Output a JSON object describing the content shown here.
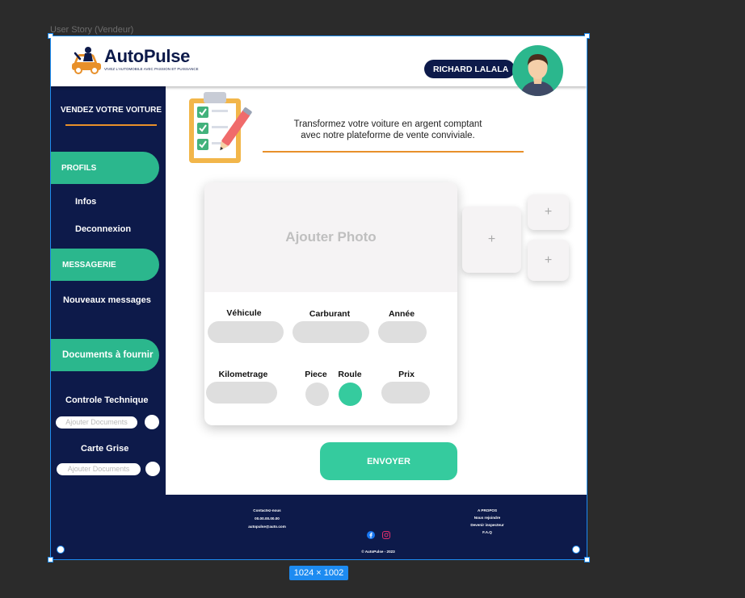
{
  "canvas": {
    "frame_label": "User Story (Vendeur)",
    "size_badge": "1024 × 1002"
  },
  "header": {
    "brand_name": "AutoPulse",
    "brand_tagline": "VIVEZ L'AUTOMOBILE AVEC PASSION ET PUISSANCE",
    "user_name": "RICHARD LALALA"
  },
  "sidebar": {
    "title": "VENDEZ VOTRE VOITURE",
    "profils_label": "PROFILS",
    "infos_label": "Infos",
    "deconnexion_label": "Deconnexion",
    "messagerie_label": "MESSAGERIE",
    "nouveaux_messages_label": "Nouveaux messages",
    "documents_label": "Documents à fournir",
    "controle_technique_label": "Controle Technique",
    "carte_grise_label": "Carte Grise",
    "ajouter_documents_label": "Ajouter Documents"
  },
  "main": {
    "tagline_line1": "Transformez votre voiture en argent comptant",
    "tagline_line2": "avec notre plateforme de vente conviviale.",
    "add_photo_label": "Ajouter Photo",
    "fields": {
      "vehicule": "Véhicule",
      "carburant": "Carburant",
      "annee": "Année",
      "kilometrage": "Kilometrage",
      "piece": "Piece",
      "roule": "Roule",
      "prix": "Prix"
    },
    "thumb_plus": "+",
    "send_label": "ENVOYER"
  },
  "footer": {
    "contact_title": "Contactez-nous",
    "phone": "00.00.00.00.00",
    "email": "autopulse@auto.com",
    "about_title": "A PROPOS",
    "link_1": "Nous rejoindre",
    "link_2": "Devenir inspecteur",
    "link_3": "F.A.Q",
    "copyright": "© AutoPulse - 2023"
  },
  "colors": {
    "navy": "#0d1a4a",
    "green": "#2bb78d",
    "button_green": "#35cb9e",
    "orange": "#e8902a",
    "selection_blue": "#1d8bf1"
  },
  "icons": [
    "logo-car-icon",
    "clipboard-checklist-icon",
    "facebook-icon",
    "instagram-icon"
  ]
}
